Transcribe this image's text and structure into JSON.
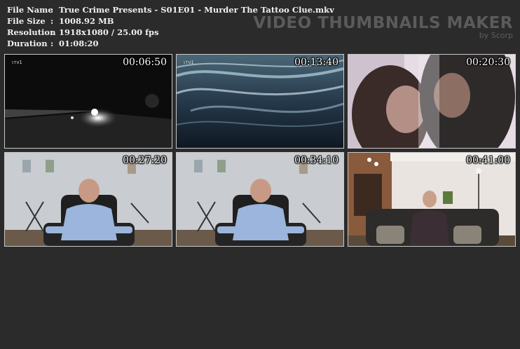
{
  "info": {
    "rows": [
      {
        "key": "File Name",
        "sep": ":",
        "value": "True Crime Presents - S01E01 - Murder The Tattoo Clue.mkv"
      },
      {
        "key": "File Size",
        "sep": ":",
        "value": "1008.92 MB"
      },
      {
        "key": "Resolution",
        "sep": ":",
        "value": "1918x1080 / 25.00 fps"
      },
      {
        "key": "Duration",
        "sep": ":",
        "value": "01:08:20"
      }
    ]
  },
  "brand": {
    "title": "VIDEO THUMBNAILS MAKER",
    "subtitle": "by Scorp"
  },
  "thumbnails": [
    {
      "timestamp": "00:06:50",
      "logo": "ιтν1",
      "scene": "night-car-headlights"
    },
    {
      "timestamp": "00:13:40",
      "logo": "ιтν1",
      "scene": "dark-water-waves"
    },
    {
      "timestamp": "00:20:30",
      "logo": "",
      "scene": "couple-close-up"
    },
    {
      "timestamp": "00:27:20",
      "logo": "ιтν1",
      "scene": "man-in-leather-chair"
    },
    {
      "timestamp": "00:34:10",
      "logo": "ιтν1",
      "scene": "man-in-leather-chair"
    },
    {
      "timestamp": "00:41:00",
      "logo": "",
      "scene": "man-on-sofa-living-room"
    }
  ]
}
